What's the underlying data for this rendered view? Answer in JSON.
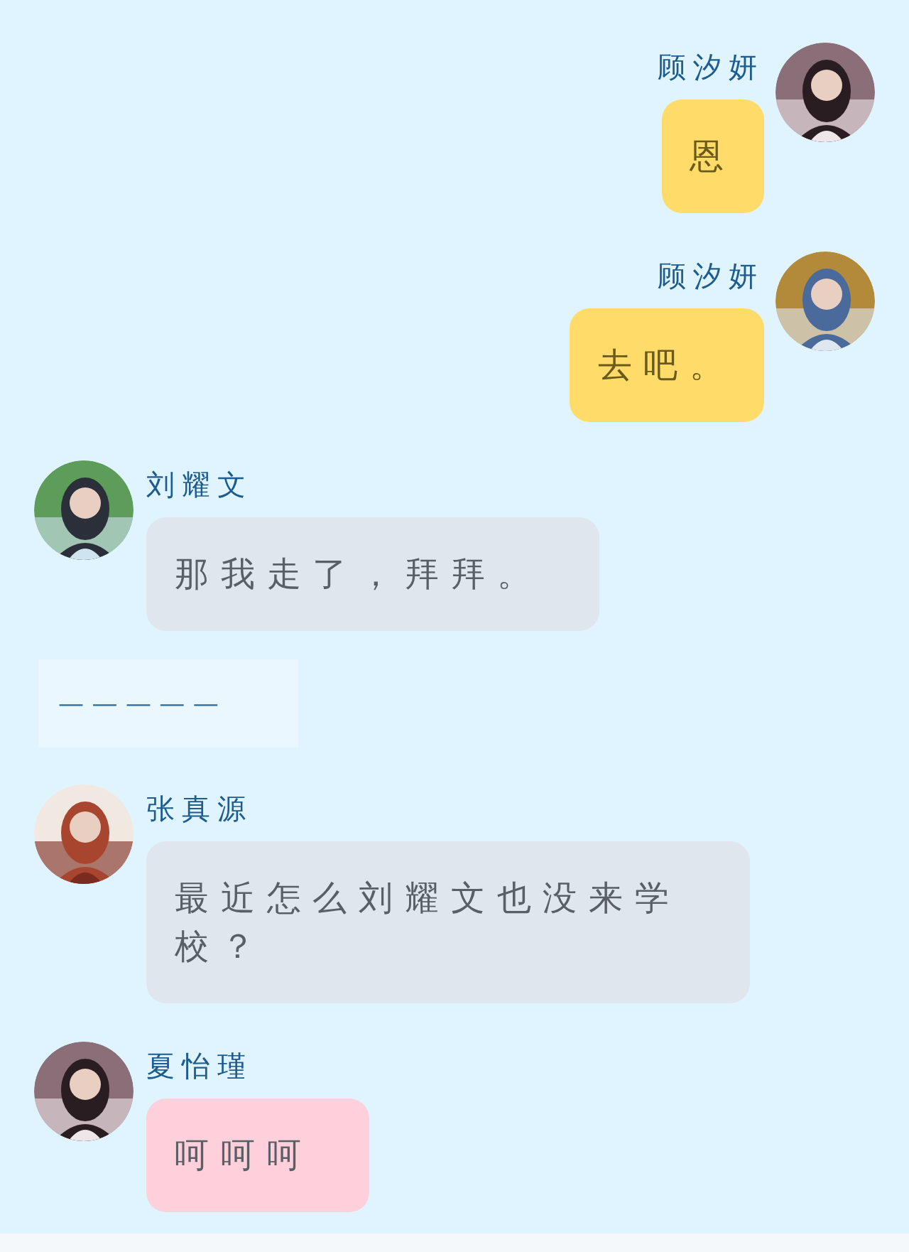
{
  "messages": [
    {
      "kind": "outgoing",
      "sender": "顾汐妍",
      "text": "恩",
      "color": "#ffdc6a"
    },
    {
      "kind": "outgoing",
      "sender": "顾汐妍",
      "text": "去吧。",
      "color": "#ffdc6a"
    },
    {
      "kind": "incoming",
      "sender": "刘耀文",
      "text": "那我走了，拜拜。",
      "color": "#e0e6ee"
    },
    {
      "kind": "divider",
      "text": "— — — — —"
    },
    {
      "kind": "incoming",
      "sender": "张真源",
      "text": "最近怎么刘耀文也没来学校？",
      "color": "#e0e6ee"
    },
    {
      "kind": "incoming",
      "sender": "夏怡瑾",
      "text": "呵呵呵",
      "color": "#fdd0dc"
    }
  ]
}
